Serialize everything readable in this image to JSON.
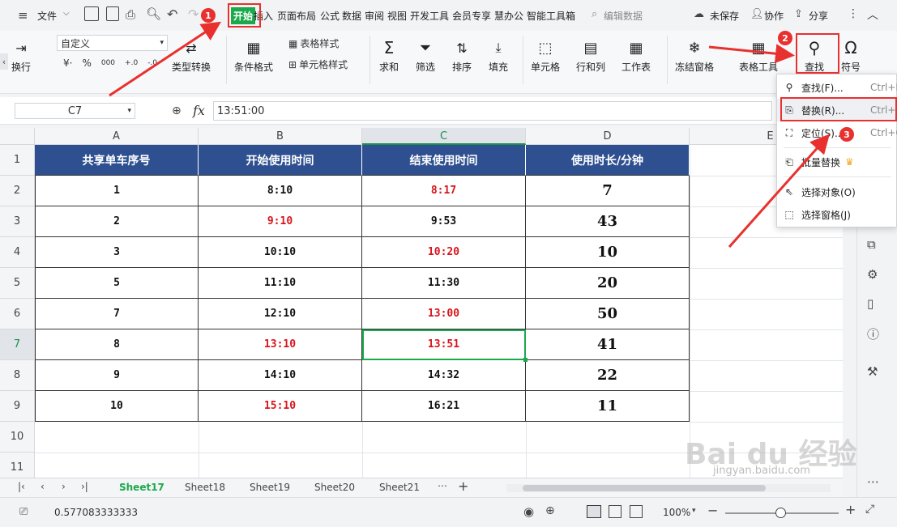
{
  "menubar": {
    "file": "文件",
    "tabs": [
      "开始",
      "插入",
      "页面布局",
      "公式",
      "数据",
      "审阅",
      "视图",
      "开发工具",
      "会员专享",
      "慧办公",
      "智能工具箱"
    ],
    "search": "编辑数据",
    "unsaved": "未保存",
    "collab": "协作",
    "share": "分享"
  },
  "ribbon": {
    "wrap": "换行",
    "number_format": "自定义",
    "type_convert": "类型转换",
    "cond_format": "条件格式",
    "table_style": "表格样式",
    "cell_style": "单元格样式",
    "sum": "求和",
    "filter": "筛选",
    "sort": "排序",
    "fill": "填充",
    "cell": "单元格",
    "row_col": "行和列",
    "worksheet": "工作表",
    "freeze": "冻结窗格",
    "table_tools": "表格工具",
    "find": "查找",
    "symbol": "符号"
  },
  "formula": {
    "name_box": "C7",
    "fx": "fx",
    "value": "13:51:00"
  },
  "columns": [
    "A",
    "B",
    "C",
    "D",
    "E"
  ],
  "rows": [
    "1",
    "2",
    "3",
    "4",
    "5",
    "6",
    "7",
    "8",
    "9",
    "10",
    "11"
  ],
  "table": {
    "headers": [
      "共享单车序号",
      "开始使用时间",
      "结束使用时间",
      "使用时长/分钟"
    ],
    "rows": [
      {
        "id": "1",
        "start": "8:10",
        "end": "8:17",
        "dur": "7"
      },
      {
        "id": "2",
        "start": "9:10",
        "end": "9:53",
        "dur": "43"
      },
      {
        "id": "3",
        "start": "10:10",
        "end": "10:20",
        "dur": "10"
      },
      {
        "id": "5",
        "start": "11:10",
        "end": "11:30",
        "dur": "20"
      },
      {
        "id": "7",
        "start": "12:10",
        "end": "13:00",
        "dur": "50"
      },
      {
        "id": "8",
        "start": "13:10",
        "end": "13:51",
        "dur": "41"
      },
      {
        "id": "9",
        "start": "14:10",
        "end": "14:32",
        "dur": "22"
      },
      {
        "id": "10",
        "start": "15:10",
        "end": "16:21",
        "dur": "11"
      }
    ]
  },
  "sheets": [
    "Sheet17",
    "Sheet18",
    "Sheet19",
    "Sheet20",
    "Sheet21"
  ],
  "status": {
    "value": "0.577083333333",
    "zoom": "100%"
  },
  "dropdown": {
    "find": "查找(F)...",
    "find_sc": "Ctrl+F",
    "replace": "替换(R)...",
    "replace_sc": "Ctrl+H",
    "goto": "定位(S)...",
    "goto_sc": "Ctrl+G",
    "batch_replace": "批量替换",
    "select_obj": "选择对象(O)",
    "select_pane": "选择窗格(J)"
  },
  "badges": [
    "1",
    "2",
    "3"
  ],
  "watermark": {
    "brand": "Bai du 经验",
    "url": "jingyan.baidu.com"
  },
  "colors": {
    "accent": "#1aa94b",
    "header_bg": "#2e5090",
    "red_text": "#d9141a",
    "annotation": "#e8312f"
  }
}
